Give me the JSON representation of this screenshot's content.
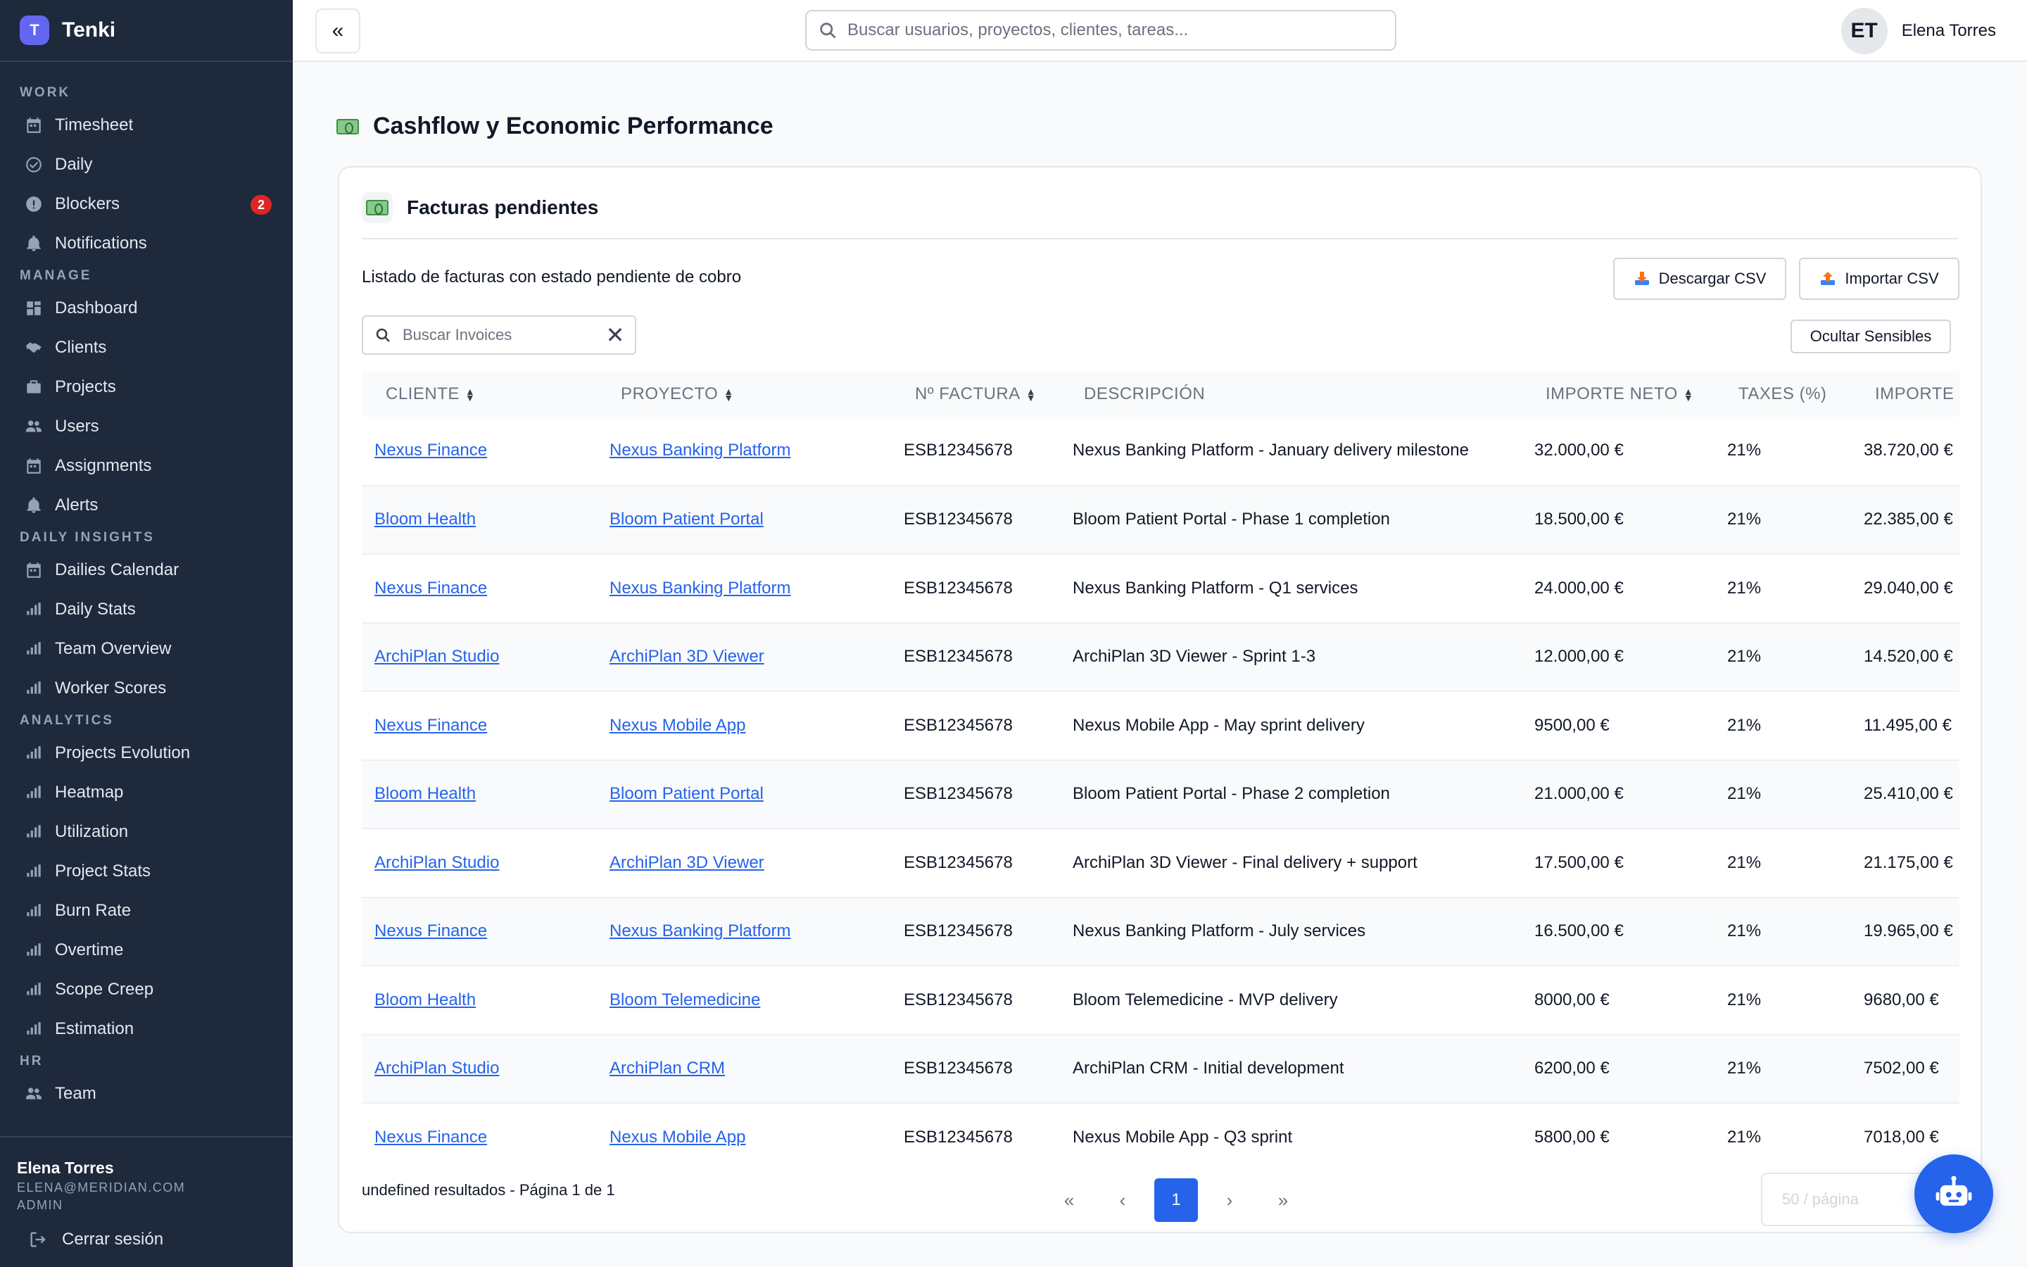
{
  "app": {
    "logo_letter": "T",
    "name": "Tenki"
  },
  "sidebar": {
    "sections": [
      {
        "title": "WORK",
        "items": [
          {
            "label": "Timesheet",
            "icon": "calendar-icon"
          },
          {
            "label": "Daily",
            "icon": "check-circle-icon"
          },
          {
            "label": "Blockers",
            "icon": "alert-icon",
            "badge": "2"
          },
          {
            "label": "Notifications",
            "icon": "bell-icon"
          }
        ]
      },
      {
        "title": "MANAGE",
        "items": [
          {
            "label": "Dashboard",
            "icon": "dashboard-icon"
          },
          {
            "label": "Clients",
            "icon": "handshake-icon"
          },
          {
            "label": "Projects",
            "icon": "briefcase-icon"
          },
          {
            "label": "Users",
            "icon": "users-icon"
          },
          {
            "label": "Assignments",
            "icon": "calendar-icon"
          },
          {
            "label": "Alerts",
            "icon": "bell-icon"
          }
        ]
      },
      {
        "title": "DAILY INSIGHTS",
        "items": [
          {
            "label": "Dailies Calendar",
            "icon": "calendar-icon"
          },
          {
            "label": "Daily Stats",
            "icon": "bar-chart-icon"
          },
          {
            "label": "Team Overview",
            "icon": "bar-chart-icon"
          },
          {
            "label": "Worker Scores",
            "icon": "bar-chart-icon"
          }
        ]
      },
      {
        "title": "ANALYTICS",
        "items": [
          {
            "label": "Projects Evolution",
            "icon": "bar-chart-icon"
          },
          {
            "label": "Heatmap",
            "icon": "bar-chart-icon"
          },
          {
            "label": "Utilization",
            "icon": "bar-chart-icon"
          },
          {
            "label": "Project Stats",
            "icon": "bar-chart-icon"
          },
          {
            "label": "Burn Rate",
            "icon": "bar-chart-icon"
          },
          {
            "label": "Overtime",
            "icon": "bar-chart-icon"
          },
          {
            "label": "Scope Creep",
            "icon": "bar-chart-icon"
          },
          {
            "label": "Estimation",
            "icon": "bar-chart-icon"
          }
        ]
      },
      {
        "title": "HR",
        "items": [
          {
            "label": "Team",
            "icon": "users-icon"
          }
        ]
      }
    ],
    "footer": {
      "name": "Elena Torres",
      "email": "ELENA@MERIDIAN.COM",
      "role": "ADMIN",
      "logout_label": "Cerrar sesión"
    }
  },
  "topbar": {
    "collapse_label": "«",
    "search_placeholder": "Buscar usuarios, proyectos, clientes, tareas...",
    "user_initials": "ET",
    "user_name": "Elena Torres"
  },
  "page": {
    "title": "Cashflow y Economic Performance"
  },
  "card": {
    "title": "Facturas pendientes",
    "description": "Listado de facturas con estado pendiente de cobro",
    "download_csv": "Descargar CSV",
    "import_csv": "Importar CSV",
    "hide_sensitive": "Ocultar Sensibles",
    "search_placeholder": "Buscar Invoices",
    "columns": [
      "CLIENTE",
      "PROYECTO",
      "Nº FACTURA",
      "DESCRIPCIÓN",
      "IMPORTE NETO",
      "TAXES (%)",
      "IMPORTE BRUTO"
    ],
    "sortable": [
      true,
      true,
      true,
      false,
      true,
      false,
      false
    ],
    "rows": [
      {
        "cliente": "Nexus Finance",
        "proyecto": "Nexus Banking Platform",
        "factura": "ESB12345678",
        "descripcion": "Nexus Banking Platform - January delivery milestone",
        "neto": "32.000,00 €",
        "taxes": "21%",
        "bruto": "38.720,00 €"
      },
      {
        "cliente": "Bloom Health",
        "proyecto": "Bloom Patient Portal",
        "factura": "ESB12345678",
        "descripcion": "Bloom Patient Portal - Phase 1 completion",
        "neto": "18.500,00 €",
        "taxes": "21%",
        "bruto": "22.385,00 €"
      },
      {
        "cliente": "Nexus Finance",
        "proyecto": "Nexus Banking Platform",
        "factura": "ESB12345678",
        "descripcion": "Nexus Banking Platform - Q1 services",
        "neto": "24.000,00 €",
        "taxes": "21%",
        "bruto": "29.040,00 €"
      },
      {
        "cliente": "ArchiPlan Studio",
        "proyecto": "ArchiPlan 3D Viewer",
        "factura": "ESB12345678",
        "descripcion": "ArchiPlan 3D Viewer - Sprint 1-3",
        "neto": "12.000,00 €",
        "taxes": "21%",
        "bruto": "14.520,00 €"
      },
      {
        "cliente": "Nexus Finance",
        "proyecto": "Nexus Mobile App",
        "factura": "ESB12345678",
        "descripcion": "Nexus Mobile App - May sprint delivery",
        "neto": "9500,00 €",
        "taxes": "21%",
        "bruto": "11.495,00 €"
      },
      {
        "cliente": "Bloom Health",
        "proyecto": "Bloom Patient Portal",
        "factura": "ESB12345678",
        "descripcion": "Bloom Patient Portal - Phase 2 completion",
        "neto": "21.000,00 €",
        "taxes": "21%",
        "bruto": "25.410,00 €"
      },
      {
        "cliente": "ArchiPlan Studio",
        "proyecto": "ArchiPlan 3D Viewer",
        "factura": "ESB12345678",
        "descripcion": "ArchiPlan 3D Viewer - Final delivery + support",
        "neto": "17.500,00 €",
        "taxes": "21%",
        "bruto": "21.175,00 €"
      },
      {
        "cliente": "Nexus Finance",
        "proyecto": "Nexus Banking Platform",
        "factura": "ESB12345678",
        "descripcion": "Nexus Banking Platform - July services",
        "neto": "16.500,00 €",
        "taxes": "21%",
        "bruto": "19.965,00 €"
      },
      {
        "cliente": "Bloom Health",
        "proyecto": "Bloom Telemedicine",
        "factura": "ESB12345678",
        "descripcion": "Bloom Telemedicine - MVP delivery",
        "neto": "8000,00 €",
        "taxes": "21%",
        "bruto": "9680,00 €"
      },
      {
        "cliente": "ArchiPlan Studio",
        "proyecto": "ArchiPlan CRM",
        "factura": "ESB12345678",
        "descripcion": "ArchiPlan CRM - Initial development",
        "neto": "6200,00 €",
        "taxes": "21%",
        "bruto": "7502,00 €"
      },
      {
        "cliente": "Nexus Finance",
        "proyecto": "Nexus Mobile App",
        "factura": "ESB12345678",
        "descripcion": "Nexus Mobile App - Q3 sprint",
        "neto": "5800,00 €",
        "taxes": "21%",
        "bruto": "7018,00 €"
      }
    ],
    "results_text": "undefined resultados - Página 1 de 1",
    "pagination": {
      "first": "«",
      "prev": "‹",
      "current": "1",
      "next": "›",
      "last": "»"
    },
    "per_page_placeholder": "50 / página"
  },
  "colors": {
    "sidebar_bg": "#1e293b",
    "accent": "#2563eb",
    "brand": "#6366f1",
    "badge": "#dc2626"
  }
}
